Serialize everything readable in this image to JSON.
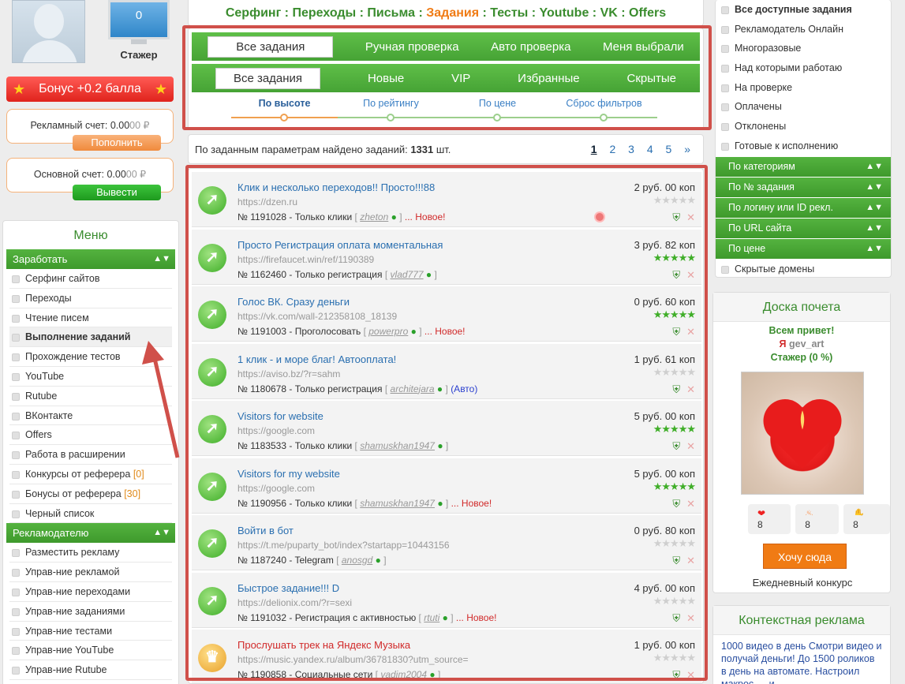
{
  "profile": {
    "balance_counter": "0",
    "rank": "Стажер",
    "bonus": "Бонус +0.2 балла"
  },
  "accounts": {
    "ad_label": "Рекламный счет: 0.00",
    "ad_suffix": "00 ₽",
    "ad_button": "Пополнить",
    "main_label": "Основной счет: 0.00",
    "main_suffix": "00 ₽",
    "main_button": "Вывести"
  },
  "menu": {
    "title": "Меню",
    "earn_section": "Заработать",
    "earn_items": [
      "Серфинг сайтов",
      "Переходы",
      "Чтение писем",
      "Выполнение заданий",
      "Прохождение тестов",
      "YouTube",
      "Rutube",
      "ВКонтакте",
      "Offers",
      "Работа в расширении",
      "Конкурсы от реферера",
      "Бонусы от реферера",
      "Черный список"
    ],
    "referrer_contests_count": "[0]",
    "referrer_bonus_count": "[30]",
    "adv_section": "Рекламодателю",
    "adv_items": [
      "Разместить рекламу",
      "Управ-ние рекламой",
      "Управ-ние переходами",
      "Управ-ние заданиями",
      "Управ-ние тестами",
      "Управ-ние YouTube",
      "Управ-ние Rutube"
    ]
  },
  "top_nav": [
    "Серфинг",
    "Переходы",
    "Письма",
    "Задания",
    "Тесты",
    "Youtube",
    "VK",
    "Offers"
  ],
  "filters": {
    "check_tabs": [
      "Все задания",
      "Ручная проверка",
      "Авто проверка",
      "Меня выбрали"
    ],
    "type_tabs": [
      "Все задания",
      "Новые",
      "VIP",
      "Избранные",
      "Скрытые"
    ],
    "sort": [
      "По высоте",
      "По рейтингу",
      "По цене",
      "Сброс фильтров"
    ]
  },
  "found": {
    "text": "По заданным параметрам найдено заданий: ",
    "count": "1331",
    "unit": " шт.",
    "pages": [
      "1",
      "2",
      "3",
      "4",
      "5",
      "»"
    ]
  },
  "tasks": [
    {
      "title": "Клик и несколько переходов!! Просто!!!88",
      "url": "https://dzen.ru",
      "meta": "№ 1191028 - Только клики",
      "user": "zheton",
      "flag": "... Новое!",
      "price": "2 руб. 00 коп",
      "stars": 0
    },
    {
      "title": "Просто Регистрация оплата моментальная",
      "url": "https://firefaucet.win/ref/1190389",
      "meta": "№ 1162460 - Только регистрация",
      "user": "vlad777",
      "flag": "",
      "price": "3 руб. 82 коп",
      "stars": 5
    },
    {
      "title": "Голос ВК. Сразу деньги",
      "url": "https://vk.com/wall-212358108_18139",
      "meta": "№ 1191003 - Проголосовать",
      "user": "powerpro",
      "flag": "... Новое!",
      "price": "0 руб. 60 коп",
      "stars": 5
    },
    {
      "title": "1 клик - и море благ! Автооплата!",
      "url": "https://aviso.bz/?r=sahm",
      "meta": "№ 1180678 - Только регистрация",
      "user": "architejara",
      "flag": "(Авто)",
      "price": "1 руб. 61 коп",
      "stars": 0
    },
    {
      "title": "Visitors for website",
      "url": "https://google.com",
      "meta": "№ 1183533 - Только клики",
      "user": "shamuskhan1947",
      "flag": "",
      "price": "5 руб. 00 коп",
      "stars": 5
    },
    {
      "title": "Visitors for my website",
      "url": "https://google.com",
      "meta": "№ 1190956 - Только клики",
      "user": "shamuskhan1947",
      "flag": "... Новое!",
      "price": "5 руб. 00 коп",
      "stars": 5
    },
    {
      "title": "Войти в бот",
      "url": "https://t.me/puparty_bot/index?startapp=10443156",
      "meta": "№ 1187240 - Telegram",
      "user": "anosgd",
      "flag": "",
      "price": "0 руб. 80 коп",
      "stars": 0
    },
    {
      "title": "Быстрое задание!!! D",
      "url": "https://delionix.com/?r=sexi",
      "meta": "№ 1191032 - Регистрация с активностью",
      "user": "rtuti",
      "flag": "... Новое!",
      "price": "4 руб. 00 коп",
      "stars": 0
    },
    {
      "title": "Прослушать трек на Яндекс Музыка",
      "url": "https://music.yandex.ru/album/36781830?utm_source=",
      "meta": "№ 1190858 - Социальные сети",
      "user": "vadim2004",
      "flag": "",
      "price": "1 руб. 00 коп",
      "stars": 0
    }
  ],
  "right_menu": {
    "items_top": [
      "Все доступные задания",
      "Рекламодатель Онлайн",
      "Многоразовые",
      "Над которыми работаю",
      "На проверке",
      "Оплачены",
      "Отклонены",
      "Готовые к исполнению"
    ],
    "sections": [
      "По категориям",
      "По № задания",
      "По логину или ID рекл.",
      "По URL сайта",
      "По цене"
    ],
    "items_bottom": [
      "Скрытые домены"
    ]
  },
  "honor": {
    "title": "Доска почета",
    "greeting": "Всем привет!",
    "ya": "Я",
    "name": "gev_art",
    "rank": "Стажер (0 %)",
    "reactions": [
      "8",
      "8",
      "8"
    ],
    "button": "Хочу сюда",
    "daily": "Ежедневный конкурс"
  },
  "ads": {
    "title": "Контекстная реклама",
    "text": "1000 видео в день Смотри видео и получай деньги! До 1500 роликов в день на автомате. Настроил макрос — и"
  }
}
